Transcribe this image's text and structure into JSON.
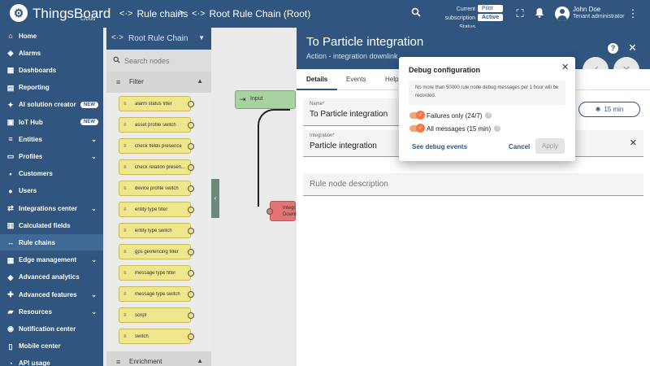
{
  "app": {
    "logo_text": "ThingsBoard",
    "logo_sub": "Cloud",
    "breadcrumb_1": "Rule chains",
    "breadcrumb_sep": ">",
    "breadcrumb_2": "Root Rule Chain (Root)",
    "subscription_label": "Current subscription",
    "status_label": "Status",
    "subscription_value": "Pilot",
    "status_value": "Active",
    "user_name": "John Doe",
    "user_role": "Tenant administrator"
  },
  "sidebar": {
    "items": [
      {
        "label": "Home",
        "icon": "home-icon",
        "glyph": "⌂"
      },
      {
        "label": "Alarms",
        "icon": "bell-icon",
        "glyph": "◆"
      },
      {
        "label": "Dashboards",
        "icon": "dashboard-icon",
        "glyph": "▦"
      },
      {
        "label": "Reporting",
        "icon": "report-icon",
        "glyph": "▤"
      },
      {
        "label": "AI solution creator",
        "icon": "sparkle-icon",
        "glyph": "✦",
        "badge": "NEW"
      },
      {
        "label": "IoT Hub",
        "icon": "hub-icon",
        "glyph": "▣",
        "badge": "NEW"
      },
      {
        "label": "Entities",
        "icon": "entities-icon",
        "glyph": "≡"
      },
      {
        "label": "Profiles",
        "icon": "profile-icon",
        "glyph": "▭"
      },
      {
        "label": "Customers",
        "icon": "customers-icon",
        "glyph": "▪"
      },
      {
        "label": "Users",
        "icon": "user-icon",
        "glyph": "●"
      },
      {
        "label": "Integrations center",
        "icon": "integration-icon",
        "glyph": "⇄"
      },
      {
        "label": "Calculated fields",
        "icon": "calculator-icon",
        "glyph": "▥"
      },
      {
        "label": "Rule chains",
        "icon": "rule-chain-icon",
        "glyph": "↔",
        "active": true
      },
      {
        "label": "Edge management",
        "icon": "edge-icon",
        "glyph": "▦"
      },
      {
        "label": "Advanced analytics",
        "icon": "analytics-icon",
        "glyph": "◈"
      },
      {
        "label": "Advanced features",
        "icon": "features-icon",
        "glyph": "✚"
      },
      {
        "label": "Resources",
        "icon": "folder-icon",
        "glyph": "▰"
      },
      {
        "label": "Notification center",
        "icon": "notification-icon",
        "glyph": "◉"
      },
      {
        "label": "Mobile center",
        "icon": "mobile-icon",
        "glyph": "▯"
      },
      {
        "label": "API usage",
        "icon": "api-icon",
        "glyph": "◔"
      }
    ]
  },
  "library": {
    "title": "Root Rule Chain",
    "search_placeholder": "Search nodes",
    "section_filter": "Filter",
    "section_enrichment": "Enrichment",
    "nodes": [
      "alarm status filter",
      "asset profile switch",
      "check fields presence",
      "check relation presen...",
      "device profile switch",
      "entity type filter",
      "entity type switch",
      "gps geofencing filter",
      "message type filter",
      "message type switch",
      "script",
      "switch"
    ]
  },
  "canvas": {
    "input_label": "Input",
    "red_node_line1": "Integr.",
    "red_node_line2": "Downli..."
  },
  "panel": {
    "title": "To Particle integration",
    "subtitle": "Action - integration downlink",
    "tabs": [
      "Details",
      "Events",
      "Help"
    ],
    "name_label": "Name*",
    "name_value": "To Particle integration",
    "integration_label": "Integration*",
    "integration_value": "Particle integration",
    "description_placeholder": "Rule node description",
    "timer_label": "15 min"
  },
  "dialog": {
    "title": "Debug configuration",
    "info": "No more than 50000 rule node debug messages per 1 hour will be recorded.",
    "failures_label": "Failures only (24/7)",
    "all_messages_label": "All messages (15 min)",
    "see_events": "See debug events",
    "cancel": "Cancel",
    "apply": "Apply"
  },
  "colors": {
    "primary": "#305680",
    "node_filter": "#f0e68c",
    "node_input": "#a7d3a0",
    "node_action": "#e57373",
    "toggle": "#f4774a"
  }
}
